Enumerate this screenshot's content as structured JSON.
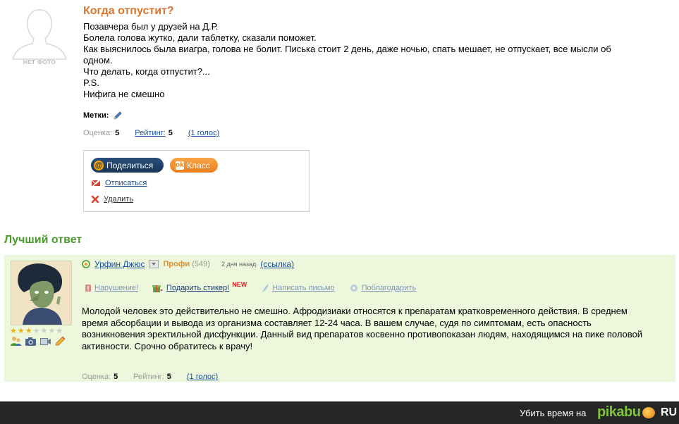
{
  "question": {
    "nophoto_label": "НЕТ ФОТО",
    "title": "Когда отпустит?",
    "lines": [
      "Позавчера был у друзей на Д.Р.",
      "Болела голова жутко, дали таблетку, сказали поможет.",
      "Как выяснилось была виагра, голова не болит. Писька стоит 2 день, даже ночью, спать мешает, не отпускает, все мысли об",
      "одном.",
      "Что делать, когда отпустит?...",
      "P.S.",
      "Нифига не смешно"
    ],
    "tags_label": "Метки:",
    "rating": {
      "score_label": "Оценка:",
      "score": "5",
      "rating_label": "Рейтинг:",
      "rating": "5",
      "votes": "(1 голос)"
    },
    "share": {
      "share_label": "Поделиться",
      "share_icon": "@",
      "klass_label": "Класс",
      "klass_icon": "ok",
      "unsubscribe_label": "Отписаться",
      "delete_label": "Удалить"
    }
  },
  "best_answer": {
    "section_title": "Лучший ответ",
    "author": "Урфин Джюс",
    "level": "Профи",
    "points": "(549)",
    "date": "2 дня назад",
    "link_label": "(ссылка)",
    "stars": {
      "filled": 3,
      "total": 7
    },
    "actions": {
      "violation": "Нарушение!",
      "sticker": "Подарить стикер!",
      "sticker_badge": "NEW",
      "write": "Написать письмо",
      "thank": "Поблагодарить"
    },
    "text": "Молодой человек это действительно не смешно. Афродизиаки относятся к препаратам кратковременного действия. В среднем время абсорбации и вывода из организма составляет 12-24 часа. В вашем случае, судя по симптомам, есть опасность возникновения эректильной дисфункции. Данный вид препаратов косвенно противопоказан людям, находящимся на пике половой активности. Срочно обратитесь к врачу!",
    "rating": {
      "score_label": "Оценка:",
      "score": "5",
      "rating_label": "Рейтинг:",
      "rating": "5",
      "votes": "(1 голос)"
    }
  },
  "footer": {
    "text": "Убить время на",
    "logo": "pikabu",
    "logo_suffix": "RU"
  },
  "colors": {
    "title_orange": "#d9762e",
    "best_green": "#4a9a2a",
    "answer_bg": "#ecf7dc",
    "link_blue": "#1a4f9c"
  }
}
